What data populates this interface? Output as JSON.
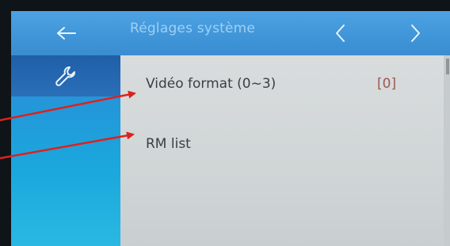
{
  "header": {
    "title": "Réglages système",
    "back_icon": "arrow-left-icon",
    "prev_icon": "chevron-left-icon",
    "next_icon": "chevron-right-icon"
  },
  "sidebar": {
    "items": [
      {
        "icon": "wrench-icon"
      }
    ]
  },
  "settings": {
    "items": [
      {
        "label": "Vidéo format (0~3)",
        "value": "[0]"
      },
      {
        "label": "RM list",
        "value": ""
      }
    ]
  },
  "colors": {
    "header": "#4da2e2",
    "sidebar_active": "#1f5fa8",
    "sidebar": "#1aa8dd",
    "panel": "#d3d8d9",
    "annotation": "#e0201a"
  }
}
